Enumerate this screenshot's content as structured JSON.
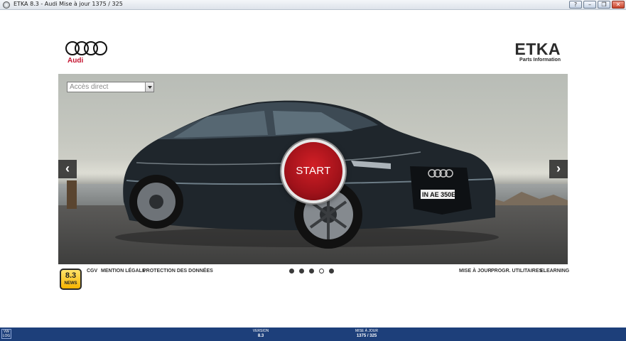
{
  "window": {
    "title": "ETKA 8.3 - Audi Mise à jour 1375 / 325",
    "buttons": [
      "?",
      "–",
      "❐",
      "✕"
    ]
  },
  "brand": {
    "audi_name": "Audi",
    "etka_title": "ETKA",
    "etka_subtitle": "Parts Information",
    "colors": {
      "audi_red": "#c4122f",
      "start_red": "#b0141c",
      "statusbar_blue": "#1d3f7a"
    }
  },
  "hero": {
    "access_placeholder": "Accès direct",
    "start_label": "START",
    "prev_icon": "chevron-left-icon",
    "next_icon": "chevron-right-icon",
    "prev_glyph": "‹",
    "next_glyph": "›",
    "license_plate": "IN AE 350E"
  },
  "news": {
    "version": "8.3",
    "label": "NEWS"
  },
  "footer_left_links": [
    "CGV",
    "MENTION LÉGALE",
    "PROTECTION DES DONNÉES"
  ],
  "footer_right_links": [
    "MISE À JOUR",
    "PROGR. UTILITAIRES",
    "ELEARNING"
  ],
  "carousel": {
    "count": 5,
    "active_index": 3
  },
  "statusbar": {
    "corner": "VW LOG",
    "version_label": "VERSION",
    "version_value": "8.3",
    "update_label": "MISE À JOUR",
    "update_value": "1375 / 325"
  }
}
